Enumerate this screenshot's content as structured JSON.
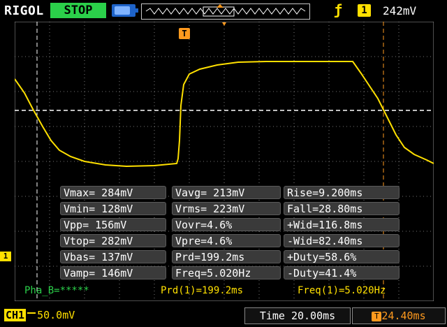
{
  "topbar": {
    "brand": "RIGOL",
    "status": "STOP",
    "trigger_source": "1",
    "trigger_level": "242mV"
  },
  "markers": {
    "trigger_marker": "T",
    "channel_marker": "1"
  },
  "measurements": [
    [
      "Vmax= 284mV",
      "Vavg= 213mV",
      "Rise=9.200ms"
    ],
    [
      "Vmin= 128mV",
      "Vrms= 223mV",
      "Fall=28.80ms"
    ],
    [
      "Vpp= 156mV",
      "Vovr=4.6%",
      "+Wid=116.8ms"
    ],
    [
      "Vtop= 282mV",
      "Vpre=4.6%",
      "-Wid=82.40ms"
    ],
    [
      "Vbas= 137mV",
      "Prd=199.2ms",
      "+Duty=58.6%"
    ],
    [
      "Vamp= 146mV",
      "Freq=5.020Hz",
      "-Duty=41.4%"
    ]
  ],
  "info": {
    "phase": "Pha_B=*****",
    "period_counter": "Prd(1)=199.2ms",
    "freq_counter": "Freq(1)=5.020Hz"
  },
  "bottombar": {
    "channel": "CH1",
    "coupling_icon": "dc-coupling-icon",
    "vertical_scale": "50.0mV",
    "timebase": "Time 20.00ms",
    "trigger_delay_icon": "trigger-delay-icon",
    "trigger_delay": "24.40ms"
  },
  "colors": {
    "trace": "#ffe000",
    "grid": "#9a9a9a",
    "status_stop": "#2bd04a",
    "accent_orange": "#ff9a1e",
    "phase_text": "#2bd04a"
  }
}
